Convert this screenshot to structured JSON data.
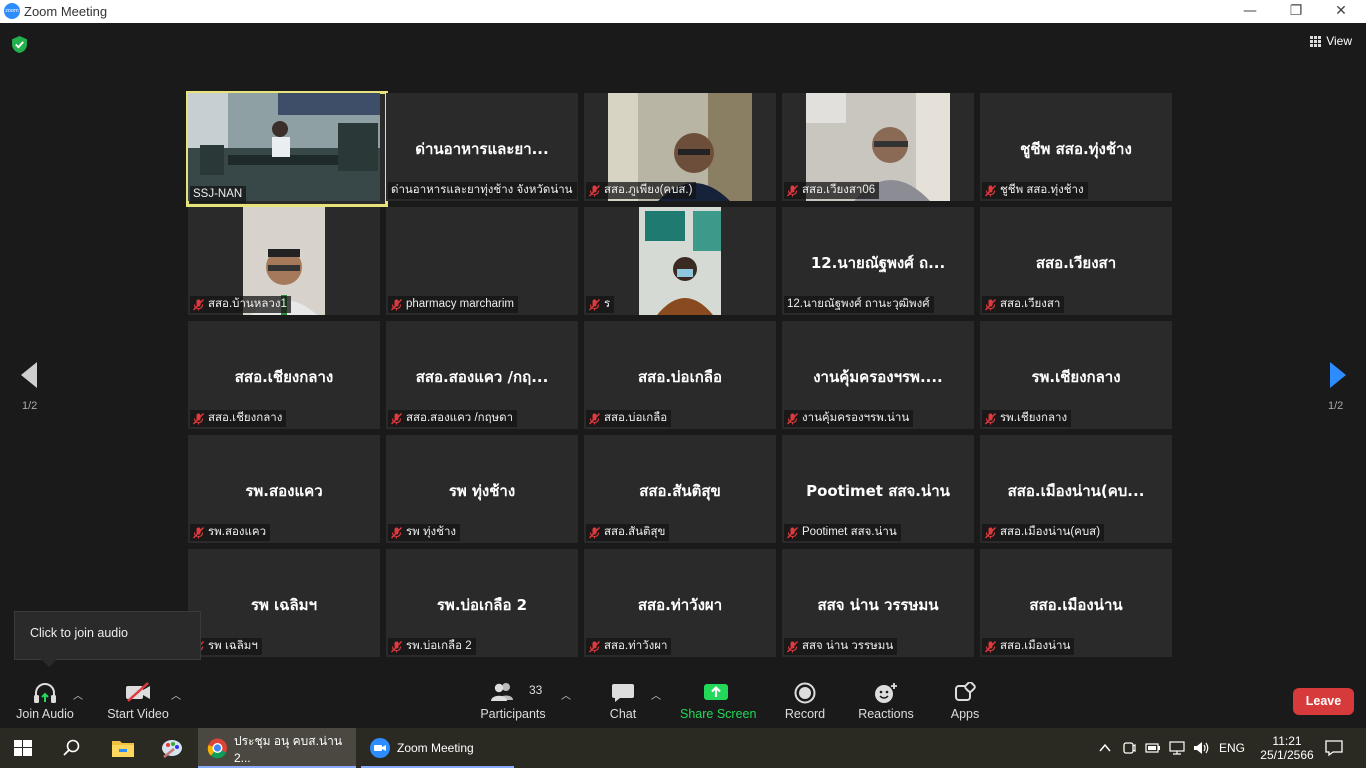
{
  "window": {
    "title": "Zoom Meeting",
    "app_icon_text": "zoom",
    "minimize": "—",
    "restore": "❐",
    "close": "✕"
  },
  "top": {
    "view_label": "View"
  },
  "navigation": {
    "page_left": "1/2",
    "page_right": "1/2"
  },
  "tiles": [
    {
      "big": "",
      "label": "SSJ-NAN",
      "muted": false,
      "video": "room"
    },
    {
      "big": "ด่านอาหารและยา...",
      "label": "ด่านอาหารและยาทุ่งช้าง จังหวัดน่าน",
      "muted": false
    },
    {
      "big": "",
      "label": "สสอ.ภูเพียง(คบส.)",
      "muted": true,
      "video": "man-glasses"
    },
    {
      "big": "",
      "label": "สสอ.เวียงสา06",
      "muted": true,
      "video": "man-office"
    },
    {
      "big": "ชูชีพ สสอ.ทุ่งช้าง",
      "label": "ชูชีพ สสอ.ทุ่งช้าง",
      "muted": true
    },
    {
      "big": "",
      "label": "สสอ.บ้านหลวง1",
      "muted": true,
      "video": "man-glasses-2"
    },
    {
      "big": "",
      "label": "pharmacy marcharim",
      "muted": true
    },
    {
      "big": "",
      "label": "ร",
      "muted": true,
      "video": "woman-mask"
    },
    {
      "big": "12.นายณัฐพงศ์ ถ...",
      "label": "12.นายณัฐพงศ์ ถานะวุฒิพงศ์",
      "muted": false
    },
    {
      "big": "สสอ.เวียงสา",
      "label": "สสอ.เวียงสา",
      "muted": true
    },
    {
      "big": "สสอ.เชียงกลาง",
      "label": "สสอ.เชียงกลาง",
      "muted": true
    },
    {
      "big": "สสอ.สองแคว /กฤ...",
      "label": "สสอ.สองแคว /กฤษดา",
      "muted": true
    },
    {
      "big": "สสอ.บ่อเกลือ",
      "label": "สสอ.บ่อเกลือ",
      "muted": true
    },
    {
      "big": "งานคุ้มครองฯรพ....",
      "label": "งานคุ้มครองฯรพ.น่าน",
      "muted": true
    },
    {
      "big": "รพ.เชียงกลาง",
      "label": "รพ.เชียงกลาง",
      "muted": true
    },
    {
      "big": "รพ.สองแคว",
      "label": "รพ.สองแคว",
      "muted": true
    },
    {
      "big": "รพ ทุ่งช้าง",
      "label": "รพ ทุ่งช้าง",
      "muted": true
    },
    {
      "big": "สสอ.สันติสุข",
      "label": "สสอ.สันติสุข",
      "muted": true
    },
    {
      "big": "Pootimet สสจ.น่าน",
      "label": "Pootimet สสจ.น่าน",
      "muted": true
    },
    {
      "big": "สสอ.เมืองน่าน(คบ...",
      "label": "สสอ.เมืองน่าน(คบส)",
      "muted": true
    },
    {
      "big": "รพ เฉลิมฯ",
      "label": "รพ เฉลิมฯ",
      "muted": true
    },
    {
      "big": "รพ.บ่อเกลือ 2",
      "label": "รพ.บ่อเกลือ 2",
      "muted": true
    },
    {
      "big": "สสอ.ท่าวังผา",
      "label": "สสอ.ท่าวังผา",
      "muted": true
    },
    {
      "big": "สสจ น่าน วรรษมน",
      "label": "สสจ น่าน วรรษมน",
      "muted": true
    },
    {
      "big": "สสอ.เมืองน่าน",
      "label": "สสอ.เมืองน่าน",
      "muted": true
    }
  ],
  "tooltip": {
    "text": "Click to join audio"
  },
  "toolbar": {
    "join_audio": "Join Audio",
    "start_video": "Start Video",
    "participants": "Participants",
    "participants_count": "33",
    "chat": "Chat",
    "share_screen": "Share Screen",
    "record": "Record",
    "reactions": "Reactions",
    "apps": "Apps",
    "leave": "Leave",
    "share_color": "#23d959",
    "leave_color": "#d73a3a"
  },
  "taskbar": {
    "chrome_title": "ประชุม อนุ คบส.น่าน 2...",
    "zoom_title": "Zoom Meeting",
    "language": "ENG",
    "time": "11:21",
    "date": "25/1/2566"
  }
}
